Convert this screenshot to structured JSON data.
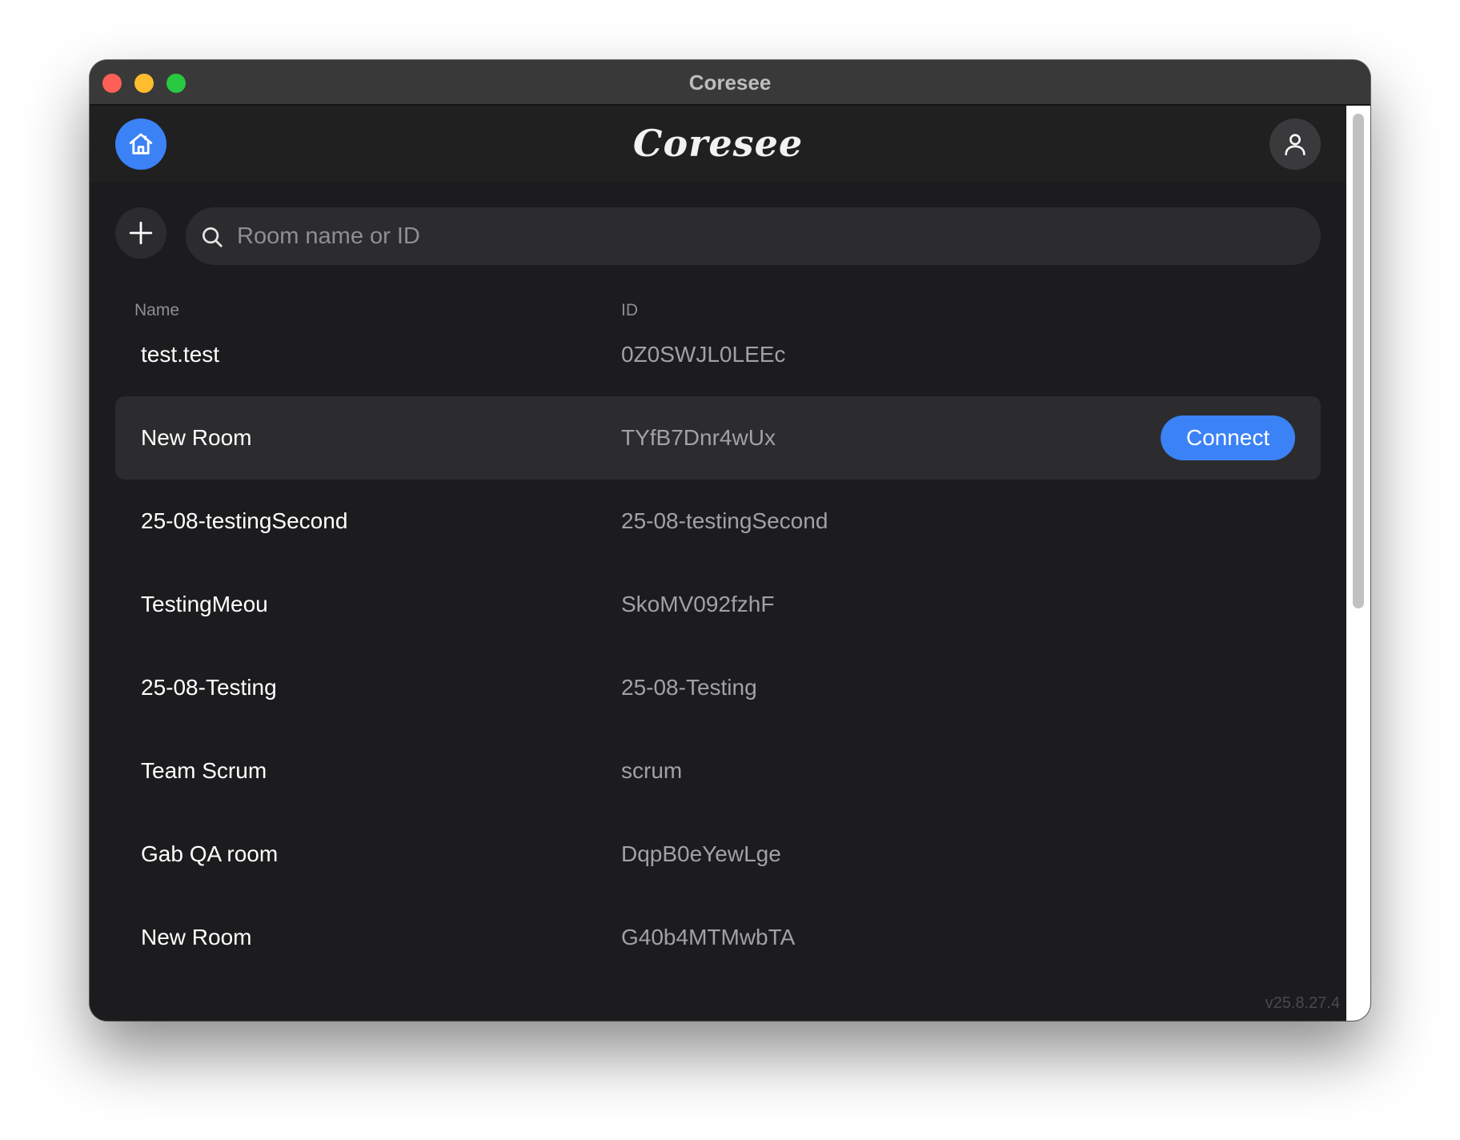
{
  "window": {
    "title": "Coresee"
  },
  "header": {
    "brand": "Coresee",
    "home_icon": "home-icon",
    "user_icon": "user-icon"
  },
  "toolbar": {
    "add_icon": "plus-icon",
    "search_icon": "search-icon",
    "search_placeholder": "Room name or ID",
    "search_value": ""
  },
  "table": {
    "columns": [
      "Name",
      "ID"
    ],
    "connect_label": "Connect",
    "selected_index": 1,
    "rows": [
      {
        "name": "test.test",
        "id": "0Z0SWJL0LEEc"
      },
      {
        "name": "New Room",
        "id": "TYfB7Dnr4wUx"
      },
      {
        "name": "25-08-testingSecond",
        "id": "25-08-testingSecond"
      },
      {
        "name": "TestingMeou",
        "id": "SkoMV092fzhF"
      },
      {
        "name": "25-08-Testing",
        "id": "25-08-Testing"
      },
      {
        "name": "Team Scrum",
        "id": "scrum"
      },
      {
        "name": "Gab QA room",
        "id": "DqpB0eYewLge"
      },
      {
        "name": "New Room",
        "id": "G40b4MTMwbTA"
      }
    ]
  },
  "footer": {
    "version": "v25.8.27.4"
  },
  "colors": {
    "accent": "#3b82f6",
    "background": "#1c1c1e",
    "selected_row": "#2c2c2e"
  }
}
